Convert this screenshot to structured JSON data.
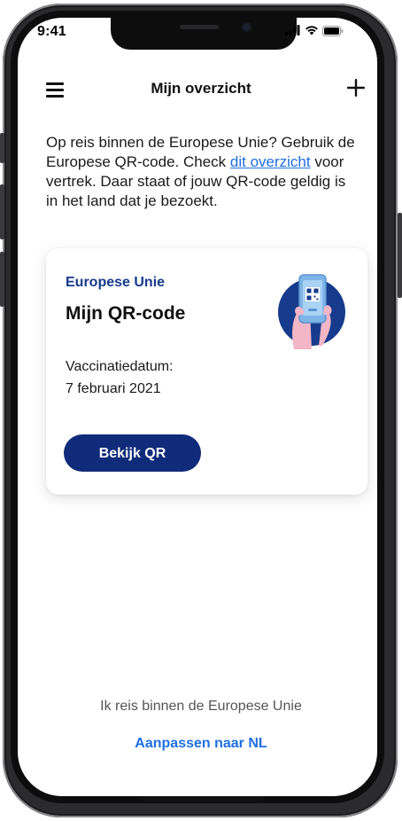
{
  "status_bar": {
    "time": "9:41",
    "signal_icon": "cellular-signal-icon",
    "wifi_icon": "wifi-icon",
    "battery_icon": "battery-icon"
  },
  "header": {
    "menu_icon": "hamburger-menu-icon",
    "title": "Mijn overzicht",
    "add_icon": "plus-icon"
  },
  "intro": {
    "text_before_link": "Op reis binnen de Europese Unie? Gebruik de Europese QR-code. Check ",
    "link_text": "dit overzicht",
    "text_after_link": " voor vertrek. Daar staat of jouw QR-code geldig is in het land dat je bezoekt."
  },
  "card": {
    "region": "Europese Unie",
    "title": "Mijn QR-code",
    "date_label": "Vaccinatiedatum:",
    "date_value": "7 februari 2021",
    "button_label": "Bekijk QR",
    "illustration_icon": "phone-qr-illustration-icon"
  },
  "footer": {
    "text": "Ik reis binnen de Europese Unie",
    "link": "Aanpassen naar NL"
  },
  "colors": {
    "primary_blue": "#0f2b7a",
    "region_blue": "#163b8c",
    "link_blue": "#1f6fe0",
    "illustration_pink": "#f3b6c6"
  }
}
